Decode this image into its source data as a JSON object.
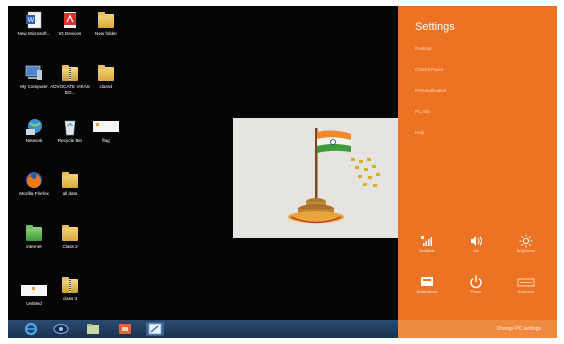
{
  "desktop": {
    "icons": [
      {
        "label": "New Microsoft...",
        "icon": "word-document-icon"
      },
      {
        "label": "IO Devices",
        "icon": "pdf-document-icon"
      },
      {
        "label": "New folder",
        "icon": "folder-icon"
      },
      {
        "label": "My Computer",
        "icon": "computer-icon"
      },
      {
        "label": "ADVOCATE VIKAS BO...",
        "icon": "zip-folder-icon"
      },
      {
        "label": "class4",
        "icon": "folder-icon"
      },
      {
        "label": "Network",
        "icon": "network-icon"
      },
      {
        "label": "Recycle Bin",
        "icon": "recycle-bin-icon"
      },
      {
        "label": "flag",
        "icon": "image-file-icon"
      },
      {
        "label": "Mozilla Firefox",
        "icon": "firefox-icon"
      },
      {
        "label": "all data",
        "icon": "folder-icon"
      },
      {
        "label": "internet",
        "icon": "green-folder-icon"
      },
      {
        "label": "Class 2",
        "icon": "folder-icon"
      },
      {
        "label": "Untitled",
        "icon": "image-file-icon"
      },
      {
        "label": "class 3",
        "icon": "zip-folder-icon"
      }
    ]
  },
  "settings": {
    "title": "Settings",
    "items": [
      "Desktop",
      "Control Panel",
      "Personalization",
      "PC info",
      "Help"
    ],
    "quick": [
      {
        "label": "Available",
        "icon": "network-signal-icon"
      },
      {
        "label": "100",
        "icon": "volume-icon"
      },
      {
        "label": "Brightness",
        "icon": "brightness-icon"
      },
      {
        "label": "Notifications",
        "icon": "notifications-icon"
      },
      {
        "label": "Power",
        "icon": "power-icon"
      },
      {
        "label": "Keyboard",
        "icon": "keyboard-icon"
      }
    ],
    "change_pc": "Change PC settings"
  },
  "taskbar": {
    "items": [
      "internet-explorer-icon",
      "media-center-icon",
      "file-explorer-icon",
      "app-icon",
      "paint-icon"
    ]
  },
  "colors": {
    "settings_bg": "#ec7224",
    "desktop_bg": "#050505",
    "taskbar": "#1f3a5c"
  }
}
